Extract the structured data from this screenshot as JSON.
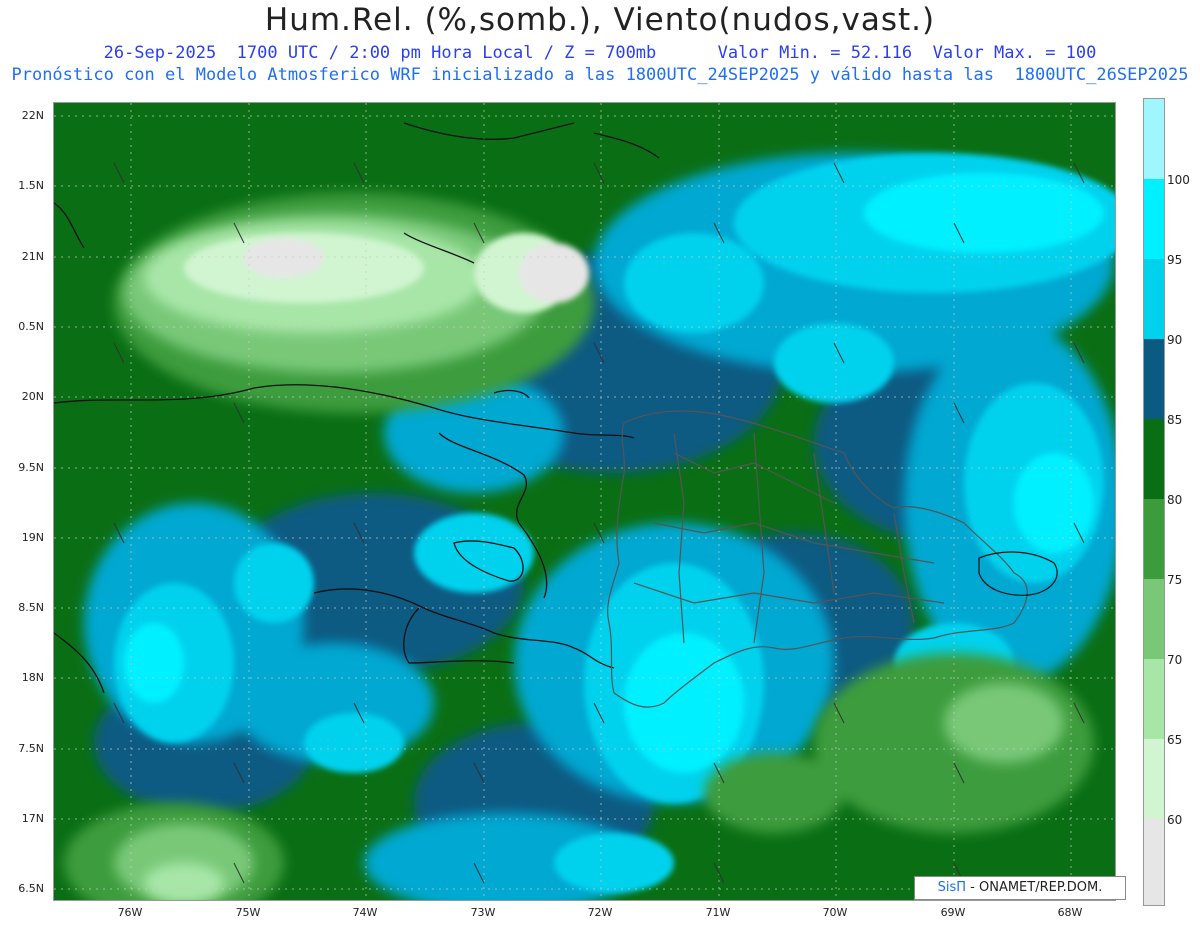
{
  "header": {
    "title": "Hum.Rel. (%,somb.), Viento(nudos,vast.)",
    "subtitle1": "26-Sep-2025  1700 UTC / 2:00 pm Hora Local / Z = 700mb      Valor Min. = 52.116  Valor Max. = 100",
    "subtitle2": "Pronóstico con el Modelo Atmosferico WRF inicializado a las 1800UTC_24SEP2025 y válido hasta las  1800UTC_26SEP2025"
  },
  "axes": {
    "y_labels": [
      "22N",
      "1.5N",
      "21N",
      "0.5N",
      "20N",
      "9.5N",
      "19N",
      "8.5N",
      "18N",
      "7.5N",
      "17N",
      "6.5N"
    ],
    "x_labels": [
      "76W",
      "75W",
      "74W",
      "73W",
      "72W",
      "71W",
      "70W",
      "69W",
      "68W"
    ]
  },
  "colorbar": {
    "labels": [
      "100",
      "95",
      "90",
      "85",
      "80",
      "75",
      "70",
      "65",
      "60"
    ],
    "colors": [
      "#e6e6e6",
      "#d0f5d0",
      "#a8e6a8",
      "#78c878",
      "#3c9c3c",
      "#0a6e14",
      "#0a5a82",
      "#00a8d2",
      "#00d2ee",
      "#00f0ff",
      "#9ff6fc"
    ]
  },
  "credit": {
    "sis": "SisΠ",
    "rest": " - ONAMET/REP.DOM."
  }
}
